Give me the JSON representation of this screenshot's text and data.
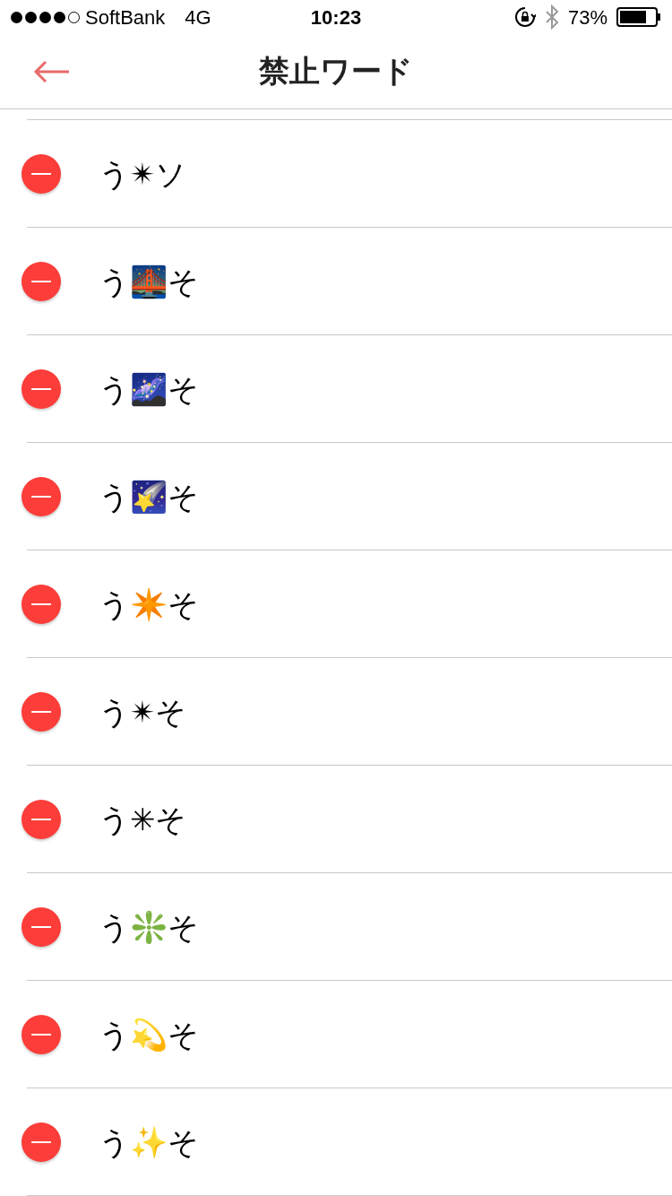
{
  "status_bar": {
    "carrier": "SoftBank",
    "network": "4G",
    "time": "10:23",
    "battery": "73%"
  },
  "nav": {
    "title": "禁止ワード"
  },
  "words": [
    {
      "text": "う✴ソ"
    },
    {
      "text": "う🌉そ"
    },
    {
      "text": "う🌌そ"
    },
    {
      "text": "う🌠そ"
    },
    {
      "text": "う✴️そ"
    },
    {
      "text": "う✴そ"
    },
    {
      "text": "う✳そ"
    },
    {
      "text": "う❇️そ"
    },
    {
      "text": "う💫そ"
    },
    {
      "text": "う✨そ"
    }
  ]
}
